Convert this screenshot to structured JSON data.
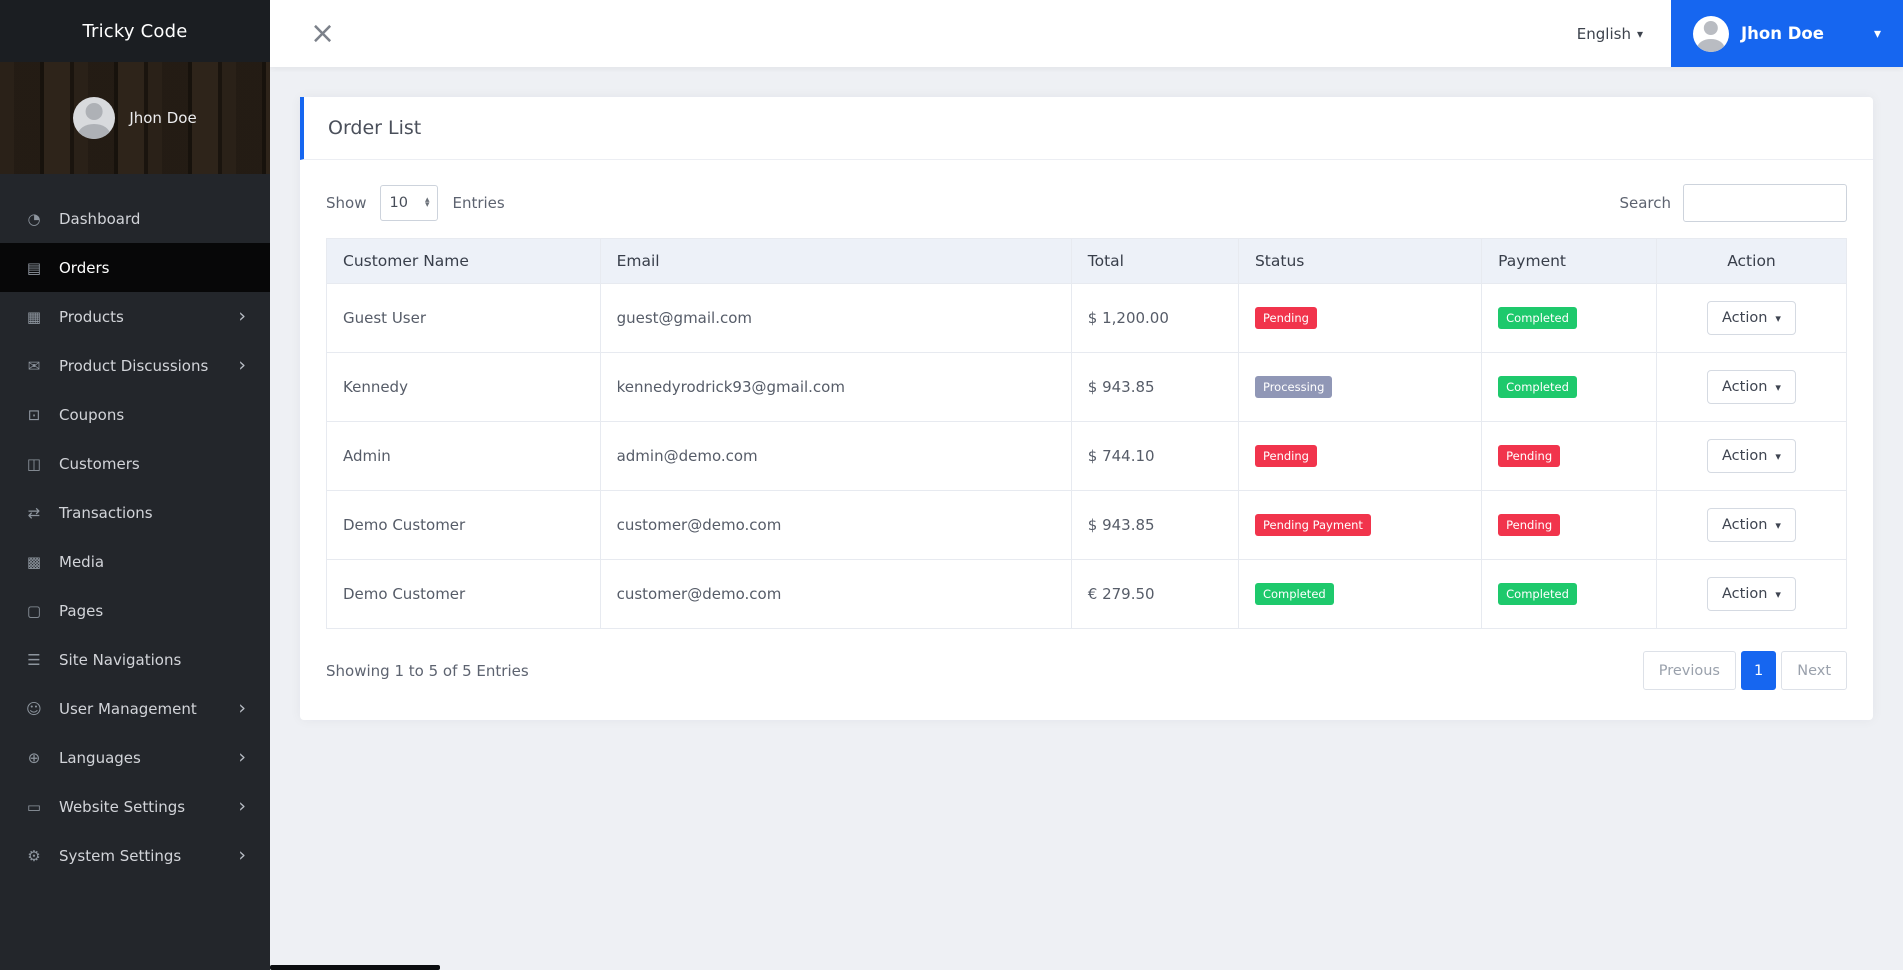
{
  "brand": {
    "name": "Tricky Code"
  },
  "sidebar": {
    "profile": {
      "name": "Jhon Doe"
    },
    "items": [
      {
        "label": "Dashboard",
        "icon": "dashboard-icon",
        "active": false,
        "has_submenu": false
      },
      {
        "label": "Orders",
        "icon": "orders-icon",
        "active": true,
        "has_submenu": false
      },
      {
        "label": "Products",
        "icon": "products-icon",
        "active": false,
        "has_submenu": true
      },
      {
        "label": "Product Discussions",
        "icon": "product-discussions-icon",
        "active": false,
        "has_submenu": true
      },
      {
        "label": "Coupons",
        "icon": "coupons-icon",
        "active": false,
        "has_submenu": false
      },
      {
        "label": "Customers",
        "icon": "customers-icon",
        "active": false,
        "has_submenu": false
      },
      {
        "label": "Transactions",
        "icon": "transactions-icon",
        "active": false,
        "has_submenu": false
      },
      {
        "label": "Media",
        "icon": "media-icon",
        "active": false,
        "has_submenu": false
      },
      {
        "label": "Pages",
        "icon": "pages-icon",
        "active": false,
        "has_submenu": false
      },
      {
        "label": "Site Navigations",
        "icon": "site-navigations-icon",
        "active": false,
        "has_submenu": false
      },
      {
        "label": "User Management",
        "icon": "user-management-icon",
        "active": false,
        "has_submenu": true
      },
      {
        "label": "Languages",
        "icon": "languages-icon",
        "active": false,
        "has_submenu": true
      },
      {
        "label": "Website Settings",
        "icon": "website-settings-icon",
        "active": false,
        "has_submenu": true
      },
      {
        "label": "System Settings",
        "icon": "system-settings-icon",
        "active": false,
        "has_submenu": true
      }
    ]
  },
  "header": {
    "language": "English",
    "user": {
      "name": "Jhon Doe"
    }
  },
  "page": {
    "title": "Order List",
    "show_label": "Show",
    "page_size": "10",
    "entries_label": "Entries",
    "search_label": "Search",
    "search_value": "",
    "summary": "Showing 1 to 5 of 5 Entries",
    "pagination": {
      "previous": "Previous",
      "current": "1",
      "next": "Next"
    }
  },
  "table": {
    "columns": [
      "Customer Name",
      "Email",
      "Total",
      "Status",
      "Payment",
      "Action"
    ],
    "action_label": "Action",
    "rows": [
      {
        "customer": "Guest User",
        "email": "guest@gmail.com",
        "total": "$ 1,200.00",
        "status": {
          "label": "Pending",
          "type": "danger"
        },
        "payment": {
          "label": "Completed",
          "type": "success"
        }
      },
      {
        "customer": "Kennedy",
        "email": "kennedyrodrick93@gmail.com",
        "total": "$ 943.85",
        "status": {
          "label": "Processing",
          "type": "secondary"
        },
        "payment": {
          "label": "Completed",
          "type": "success"
        }
      },
      {
        "customer": "Admin",
        "email": "admin@demo.com",
        "total": "$ 744.10",
        "status": {
          "label": "Pending",
          "type": "danger"
        },
        "payment": {
          "label": "Pending",
          "type": "danger"
        }
      },
      {
        "customer": "Demo Customer",
        "email": "customer@demo.com",
        "total": "$ 943.85",
        "status": {
          "label": "Pending Payment",
          "type": "danger"
        },
        "payment": {
          "label": "Pending",
          "type": "danger"
        }
      },
      {
        "customer": "Demo Customer",
        "email": "customer@demo.com",
        "total": "€ 279.50",
        "status": {
          "label": "Completed",
          "type": "success"
        },
        "payment": {
          "label": "Completed",
          "type": "success"
        }
      }
    ]
  },
  "colors": {
    "primary": "#1666f0",
    "badge_danger": "#f1344c",
    "badge_success": "#1ec96c",
    "badge_secondary": "#9097b6"
  }
}
